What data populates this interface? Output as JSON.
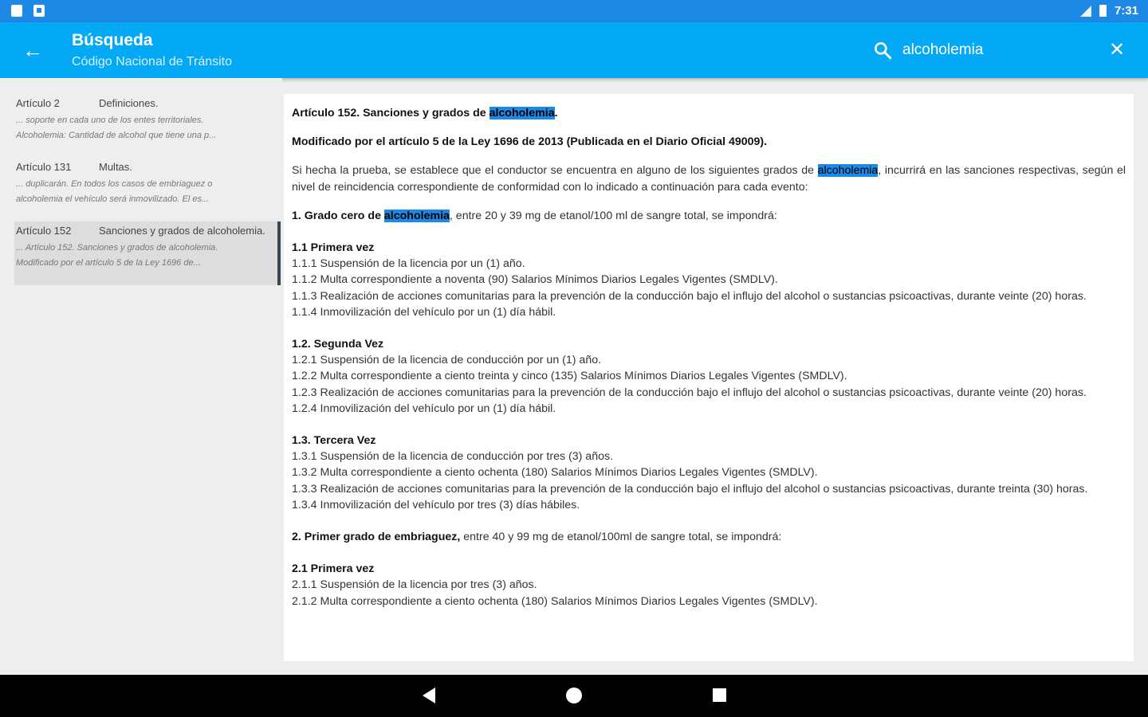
{
  "status_bar": {
    "time": "7:31"
  },
  "app_bar": {
    "title": "Búsqueda",
    "subtitle": "Código Nacional de Tránsito",
    "search_value": "alcoholemia"
  },
  "results": [
    {
      "article": "Artículo 2",
      "heading": "Definiciones.",
      "snippet1": "... soporte en cada uno de los entes territoriales.",
      "snippet2": "Alcoholemia: Cantidad de alcohol que tiene una p..."
    },
    {
      "article": "Artículo 131",
      "heading": "Multas.",
      "snippet1": "... duplicarán. En todos los casos de embriaguez o",
      "snippet2": "alcoholemia el vehículo será inmovilizado. El es..."
    },
    {
      "article": "Artículo 152",
      "heading": "Sanciones y grados de alcoholemia.",
      "snippet1": "... Artículo 152. Sanciones y grados de alcoholemia.",
      "snippet2": "Modificado por el artículo 5 de la Ley 1696 de..."
    }
  ],
  "document": {
    "title_pre": "Artículo 152. Sanciones y grados de ",
    "title_hl": "alcoholemia",
    "title_post": ".",
    "modified": "Modificado por el artículo 5 de la Ley 1696 de 2013 (Publicada en el Diario Oficial 49009).",
    "intro_pre": "Si hecha la prueba, se establece que el conductor se encuentra en alguno de los siguientes grados de ",
    "intro_hl": "alcoholemia",
    "intro_post": ", incurrirá en las sanciones respectivas, según el nivel de reincidencia correspondiente de conformidad con lo indicado a continuación para cada evento:",
    "grade1_pre": "1. Grado cero de ",
    "grade1_hl": "alcoholemia",
    "grade1_post": ", entre 20 y 39 mg de etanol/100 ml de sangre total, se impondrá:",
    "s11_title": "1.1 Primera vez",
    "s11": [
      "1.1.1 Suspensión de la licencia por un (1) año.",
      "1.1.2 Multa correspondiente a noventa (90) Salarios Mínimos Diarios Legales Vigentes (SMDLV).",
      "1.1.3 Realización de acciones comunitarias para la prevención de la conducción bajo el influjo del alcohol o sustancias psicoactivas, durante veinte (20) horas.",
      "1.1.4 Inmovilización del vehículo por un (1) día hábil."
    ],
    "s12_title": "1.2. Segunda Vez",
    "s12": [
      "1.2.1 Suspensión de la licencia de conducción por un (1) año.",
      "1.2.2 Multa correspondiente a ciento treinta y cinco (135) Salarios Mínimos Diarios Legales Vigentes (SMDLV).",
      "1.2.3 Realización de acciones comunitarias para la prevención de la conducción bajo el influjo del alcohol o sustancias psicoactivas, durante veinte (20) horas.",
      "1.2.4 Inmovilización del vehículo por un (1) día hábil."
    ],
    "s13_title": "1.3. Tercera Vez",
    "s13": [
      "1.3.1 Suspensión de la licencia de conducción por tres (3) años.",
      "1.3.2 Multa correspondiente a ciento ochenta (180) Salarios Mínimos Diarios Legales Vigentes (SMDLV).",
      "1.3.3 Realización de acciones comunitarias para la prevención de la conducción bajo el influjo del alcohol o sustancias psicoactivas, durante treinta (30) horas.",
      "1.3.4 Inmovilización del vehículo por tres (3) días hábiles."
    ],
    "grade2_bold": "2. Primer grado de embriaguez,",
    "grade2_rest": " entre 40 y 99 mg de etanol/100ml de sangre total, se impondrá:",
    "s21_title": "2.1 Primera vez",
    "s21": [
      "2.1.1 Suspensión de la licencia por tres (3) años.",
      "2.1.2 Multa correspondiente a ciento ochenta (180) Salarios Mínimos Diarios Legales Vigentes (SMDLV)."
    ]
  }
}
